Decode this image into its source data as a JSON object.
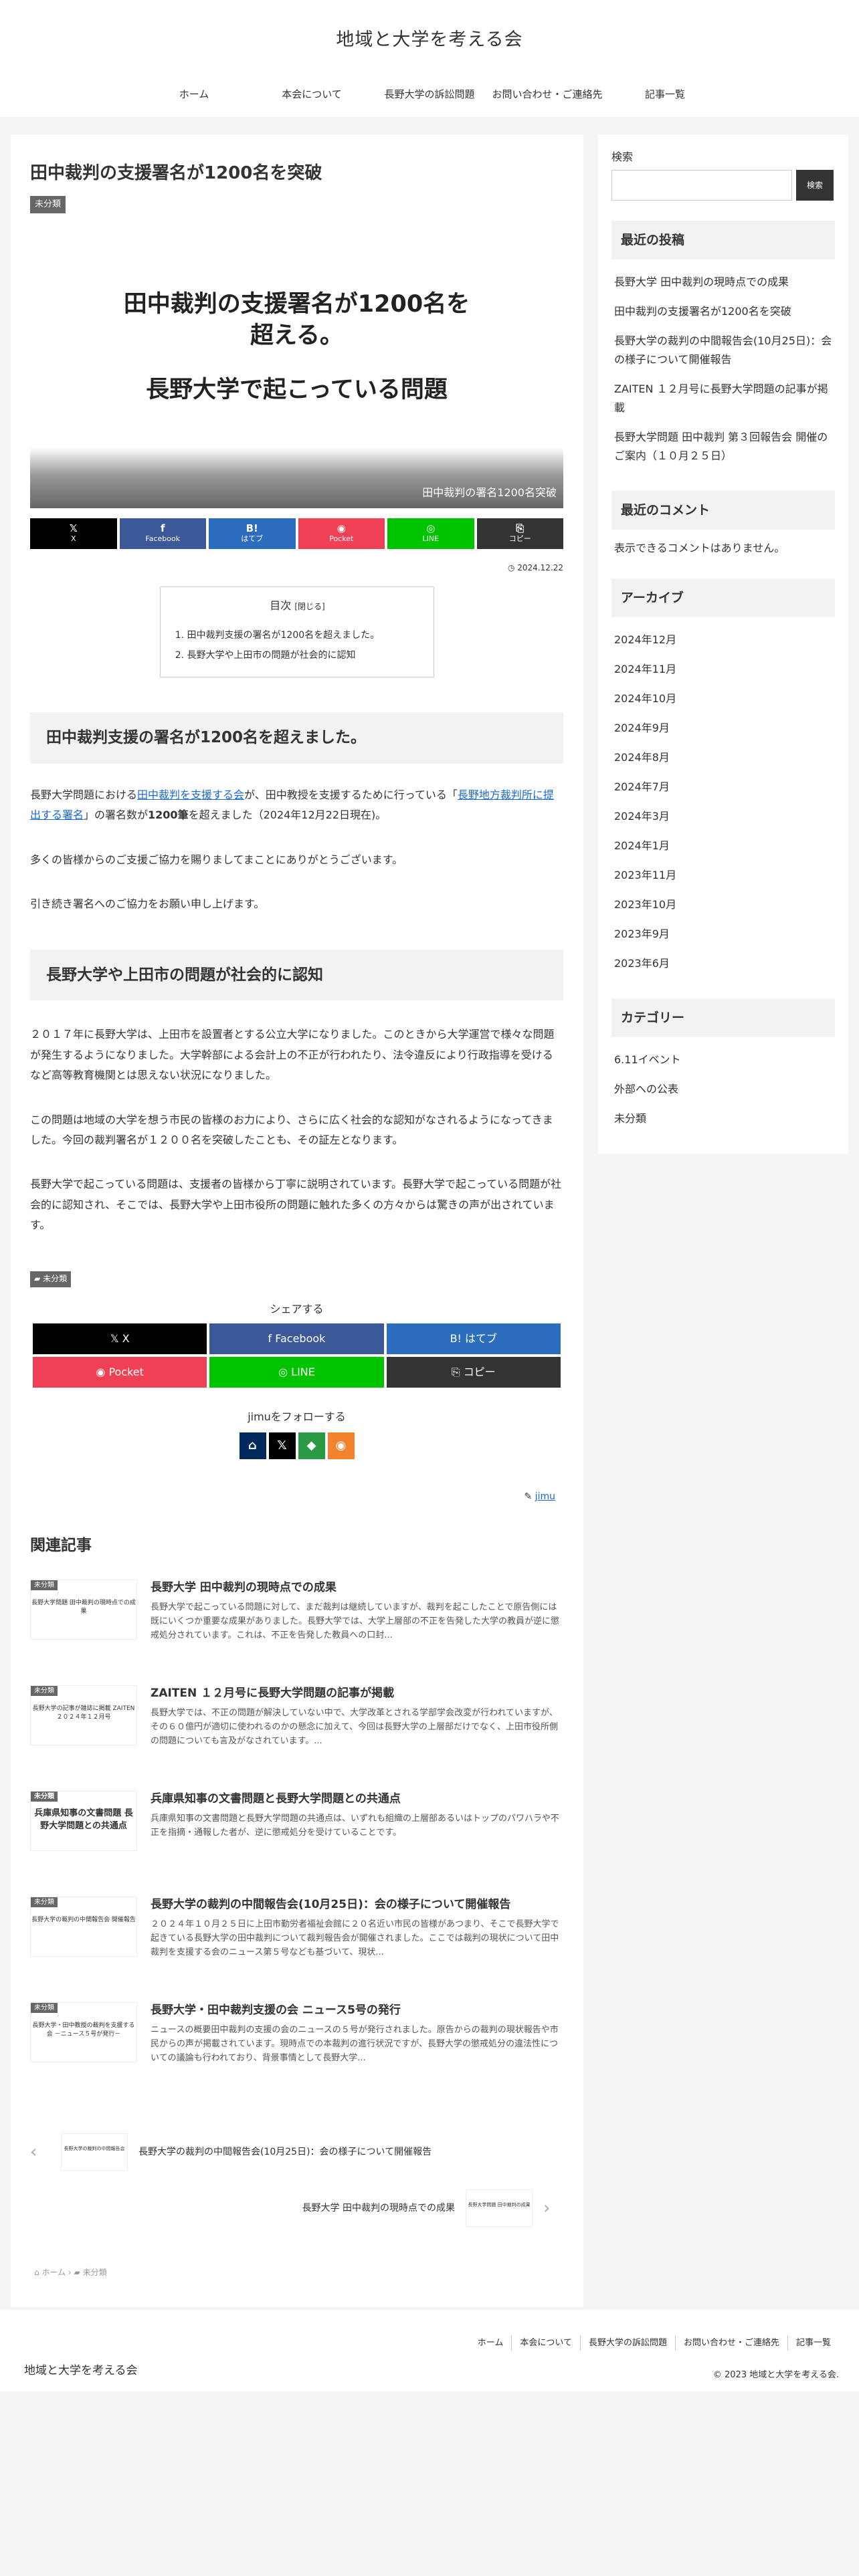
{
  "site": {
    "title": "地域と大学を考える会"
  },
  "nav": [
    {
      "label": "ホーム"
    },
    {
      "label": "本会について"
    },
    {
      "label": "長野大学の訴訟問題"
    },
    {
      "label": "お問い合わせ・ご連絡先"
    },
    {
      "label": "記事一覧"
    }
  ],
  "article": {
    "title": "田中裁判の支援署名が1200名を突破",
    "category": "未分類",
    "eyecatch": {
      "line1": "田中裁判の支援署名が1200名を",
      "line1b": "超える。",
      "line2": "長野大学で起こっている問題",
      "caption": "田中裁判の署名1200名突破"
    },
    "date": "2024.12.22",
    "toc": {
      "title": "目次",
      "close": "[閉じる]",
      "items": [
        "田中裁判支援の署名が1200名を超えました。",
        "長野大学や上田市の問題が社会的に認知"
      ]
    },
    "h2_1": "田中裁判支援の署名が1200名を超えました。",
    "p1": {
      "a": "長野大学問題における",
      "link1": "田中裁判を支援する会",
      "b": "が、田中教授を支援するために行っている「",
      "link2": "長野地方裁判所に提出する署名",
      "c": "」の署名数が",
      "bold": "1200筆",
      "d": "を超えました（2024年12月22日現在)。"
    },
    "p2": "多くの皆様からのご支援ご協力を賜りましてまことにありがとうございます。",
    "p3": "引き続き署名へのご協力をお願い申し上げます。",
    "h2_2": "長野大学や上田市の問題が社会的に認知",
    "p4": "２０１７年に長野大学は、上田市を設置者とする公立大学になりました。このときから大学運営で様々な問題が発生するようになりました。大学幹部による会計上の不正が行われたり、法令違反により行政指導を受けるなど高等教育機関とは思えない状況になりました。",
    "p5": "この問題は地域の大学を想う市民の皆様のお力により、さらに広く社会的な認知がなされるようになってきました。今回の裁判署名が１２００名を突破したことも、その証左となります。",
    "p6": "長野大学で起こっている問題は、支援者の皆様から丁寧に説明されています。長野大学で起こっている問題が社会的に認知され、そこでは、長野大学や上田市役所の問題に触れた多くの方々からは驚きの声が出されています。"
  },
  "sns_top": [
    {
      "icon": "𝕏",
      "label": "X",
      "color": "#000000"
    },
    {
      "icon": "f",
      "label": "Facebook",
      "color": "#3b5998"
    },
    {
      "icon": "B!",
      "label": "はてブ",
      "color": "#2c6ebd"
    },
    {
      "icon": "◉",
      "label": "Pocket",
      "color": "#ef4056"
    },
    {
      "icon": "◎",
      "label": "LINE",
      "color": "#00c300"
    },
    {
      "icon": "⎘",
      "label": "コピー",
      "color": "#333333"
    }
  ],
  "share": {
    "title": "シェアする",
    "buttons": [
      {
        "label": "𝕏  X",
        "color": "#000000"
      },
      {
        "label": "f  Facebook",
        "color": "#3b5998"
      },
      {
        "label": "B!  はてブ",
        "color": "#2c6ebd"
      },
      {
        "label": "◉  Pocket",
        "color": "#ef4056"
      },
      {
        "label": "◎  LINE",
        "color": "#00c300"
      },
      {
        "label": "⎘  コピー",
        "color": "#333333"
      }
    ]
  },
  "follow": {
    "title": "jimuをフォローする",
    "icons": [
      {
        "icon": "⌂",
        "color": "#002a5c"
      },
      {
        "icon": "𝕏",
        "color": "#000000"
      },
      {
        "icon": "◆",
        "color": "#2a9a45"
      },
      {
        "icon": "◉",
        "color": "#f2822e"
      }
    ]
  },
  "author": "jimu",
  "related": {
    "title": "関連記事",
    "items": [
      {
        "badge": "未分類",
        "thumb": "長野大学問題 田中裁判の現時点での成果",
        "title": "長野大学 田中裁判の現時点での成果",
        "excerpt": "長野大学で起こっている問題に対して、まだ裁判は継続していますが、裁判を起こしたことで原告側には既にいくつか重要な成果がありました。長野大学では、大学上層部の不正を告発した大学の教員が逆に懲戒処分されています。これは、不正を告発した教員への口封..."
      },
      {
        "badge": "未分類",
        "thumb": "長野大学の記事が雑誌に掲載 ZAITEN ２０２４年１２月号",
        "title": "ZAITEN １２月号に長野大学問題の記事が掲載",
        "excerpt": "長野大学では、不正の問題が解決していない中で、大学改革とされる学部学会改変が行われていますが、その６０億円が適切に使われるのかの懸念に加えて、今回は長野大学の上層部だけでなく、上田市役所側の問題についても言及がなされています。..."
      },
      {
        "badge": "未分類",
        "thumb": "兵庫県知事の文書問題 長野大学問題との共通点",
        "title": "兵庫県知事の文書問題と長野大学問題との共通点",
        "excerpt": "兵庫県知事の文書問題と長野大学問題の共通点は、いずれも組織の上層部あるいはトップのパワハラや不正を指摘・通報した者が、逆に懲戒処分を受けていることです。"
      },
      {
        "badge": "未分類",
        "thumb": "長野大学の裁判の中間報告会 開催報告",
        "title": "長野大学の裁判の中間報告会(10月25日)：会の様子について開催報告",
        "excerpt": "２０２４年１０月２５日に上田市勤労者福祉会館に２０名近い市民の皆様があつまり、そこで長野大学で起きている長野大学の田中裁判について裁判報告会が開催されました。ここでは裁判の現状について田中裁判を支援する会のニュース第５号なども基づいて、現状..."
      },
      {
        "badge": "未分類",
        "thumb": "長野大学・田中教授の裁判を支援する会 －ニュース５号が発行－",
        "title": "長野大学・田中裁判支援の会 ニュース5号の発行",
        "excerpt": "ニュースの概要田中裁判の支援の会のニュースの５号が発行されました。原告からの裁判の現状報告や市民からの声が掲載されています。現時点での本裁判の進行状況ですが、長野大学の懲戒処分の違法性についての議論も行われており、背景事情として長野大学..."
      }
    ]
  },
  "pager": {
    "prev": {
      "title": "長野大学の裁判の中間報告会(10月25日)：会の様子について開催報告",
      "thumb": "長野大学の裁判の中間報告会"
    },
    "next": {
      "title": "長野大学 田中裁判の現時点での成果",
      "thumb": "長野大学問題 田中裁判の成果"
    }
  },
  "breadcrumb": {
    "home": "ホーム",
    "cat": "未分類"
  },
  "sidebar": {
    "search_label": "検索",
    "search_button": "検索",
    "recent_title": "最近の投稿",
    "recent": [
      "長野大学 田中裁判の現時点での成果",
      "田中裁判の支援署名が1200名を突破",
      "長野大学の裁判の中間報告会(10月25日)：会の様子について開催報告",
      "ZAITEN １２月号に長野大学問題の記事が掲載",
      "長野大学問題 田中裁判 第３回報告会 開催のご案内（１０月２５日）"
    ],
    "comments_title": "最近のコメント",
    "comments_empty": "表示できるコメントはありません。",
    "archive_title": "アーカイブ",
    "archives": [
      "2024年12月",
      "2024年11月",
      "2024年10月",
      "2024年9月",
      "2024年8月",
      "2024年7月",
      "2024年3月",
      "2024年1月",
      "2023年11月",
      "2023年10月",
      "2023年9月",
      "2023年6月"
    ],
    "category_title": "カテゴリー",
    "categories": [
      "6.11イベント",
      "外部への公表",
      "未分類"
    ]
  },
  "footer": {
    "nav": [
      "ホーム",
      "本会について",
      "長野大学の訴訟問題",
      "お問い合わせ・ご連絡先",
      "記事一覧"
    ],
    "site": "地域と大学を考える会",
    "copyright": "© 2023 地域と大学を考える会."
  }
}
